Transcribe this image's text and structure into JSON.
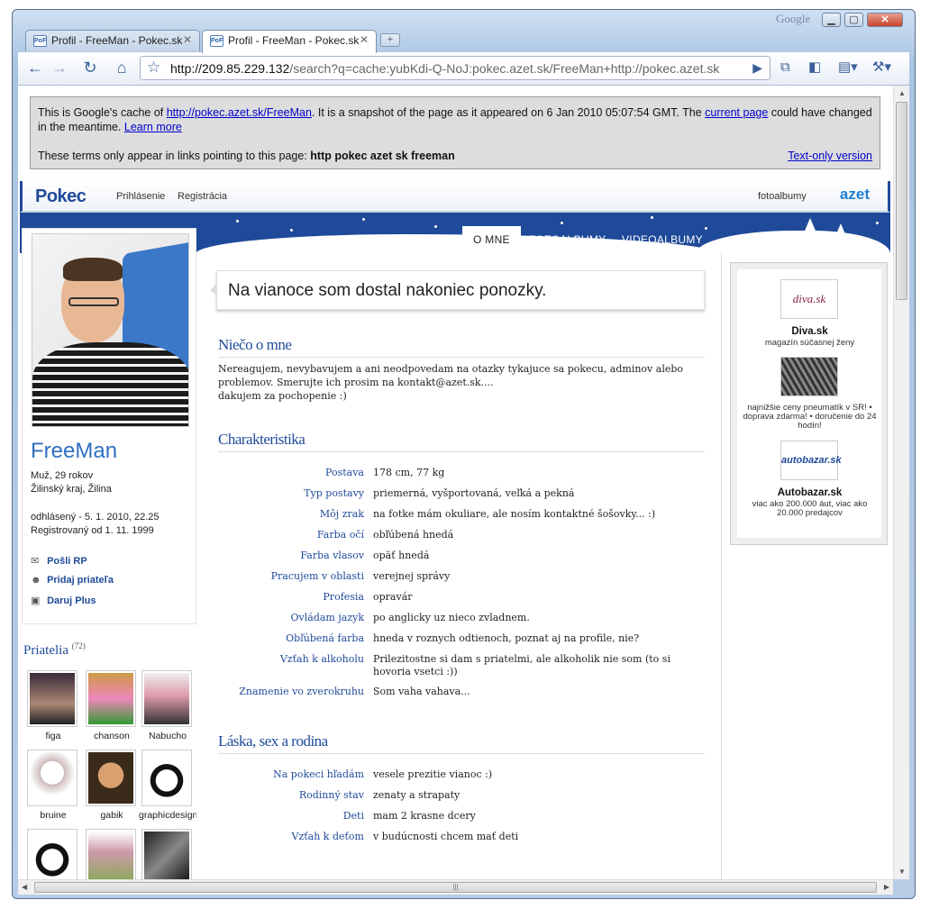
{
  "window": {
    "brand": "Google",
    "buttons": {
      "minimize": "▁",
      "maximize": "▢",
      "close": "✕"
    }
  },
  "tabs": [
    {
      "label": "Profil - FreeMan - Pokec.sk",
      "favicon": "PoF",
      "active": false
    },
    {
      "label": "Profil - FreeMan - Pokec.sk",
      "favicon": "PoF",
      "active": true
    }
  ],
  "toolbar": {
    "url_host": "http://209.85.229.132",
    "url_rest": "/search?q=cache:yubKdi-Q-NoJ:pokec.azet.sk/FreeMan+http://pokec.azet.sk",
    "icons": [
      "back-icon",
      "forward-icon",
      "reload-icon",
      "home-icon",
      "star-icon",
      "go-icon",
      "translate-icon",
      "extension-icon",
      "page-menu-icon",
      "wrench-icon"
    ]
  },
  "cache": {
    "p1_a": "This is Google's cache of ",
    "p1_link": "http://pokec.azet.sk/FreeMan",
    "p1_b": ". It is a snapshot of the page as it appeared on 6 Jan 2010 05:07:54 GMT. The ",
    "current_page": "current page",
    "p1_c": " could have changed in the meantime. ",
    "learn_more": "Learn more",
    "terms_label": "These terms only appear in links pointing to this page: ",
    "terms": "http pokec azet sk freeman",
    "text_only": "Text-only version"
  },
  "pokec": {
    "logo": "Pokec",
    "nav": [
      "Prihlásenie",
      "Registrácia"
    ],
    "right_link": "fotoalbumy",
    "azet_logo": "azet",
    "profile_tabs": [
      "O MNE",
      "FOTOALBUMY",
      "VIDEOALBUMY"
    ]
  },
  "profile": {
    "name": "FreeMan",
    "line1": "Muž, 29 rokov",
    "line2": "Žilinský kraj, Žilina",
    "line3": "odhlásený - 5. 1. 2010, 22.25",
    "line4": "Registrovaný od 1. 11. 1999",
    "actions": [
      "Pošli RP",
      "Pridaj priateľa",
      "Daruj Plus"
    ]
  },
  "friends": {
    "title": "Priatelia",
    "count": "(72)",
    "items": [
      "figa",
      "chanson",
      "Nabucho",
      "bruine",
      "gabik",
      "graphicdesign",
      "",
      "",
      ""
    ]
  },
  "status": "Na vianoce som dostal nakoniec ponozky.",
  "about": {
    "title": "Niečo o mne",
    "text1": "Nereagujem, nevybavujem a ani neodpovedam na otazky tykajuce sa pokecu, adminov alebo problemov. Smerujte ich prosim na kontakt@azet.sk....",
    "text2": "dakujem za pochopenie :)"
  },
  "char": {
    "title": "Charakteristika",
    "rows": [
      {
        "label": "Postava",
        "value": "178 cm, 77 kg"
      },
      {
        "label": "Typ postavy",
        "value": "priemerná, vyšportovaná, veľká a pekná"
      },
      {
        "label": "Môj zrak",
        "value": "na fotke mám okuliare, ale nosím kontaktné šošovky... :)"
      },
      {
        "label": "Farba očí",
        "value": "obľúbená hnedá"
      },
      {
        "label": "Farba vlasov",
        "value": "opäť hnedá"
      },
      {
        "label": "Pracujem v oblasti",
        "value": "verejnej správy"
      },
      {
        "label": "Profesia",
        "value": "opravár"
      },
      {
        "label": "Ovládam jazyk",
        "value": "po anglicky uz nieco zvladnem."
      },
      {
        "label": "Obľúbená farba",
        "value": "hneda v roznych odtienoch, poznat aj na profile, nie?"
      },
      {
        "label": "Vzťah k alkoholu",
        "value": "Prilezitostne si dam s priatelmi, ale alkoholik nie som (to si hovoria vsetci :))"
      },
      {
        "label": "Znamenie vo zverokruhu",
        "value": "Som vaha vahava..."
      }
    ]
  },
  "love": {
    "title": "Láska, sex a rodina",
    "rows": [
      {
        "label": "Na pokeci hľadám",
        "value": "vesele prezitie vianoc :)"
      },
      {
        "label": "Rodinný stav",
        "value": "zenaty a strapaty"
      },
      {
        "label": "Deti",
        "value": "mam 2 krasne dcery"
      },
      {
        "label": "Vzťah k deťom",
        "value": "v budúcnosti chcem mať deti"
      }
    ]
  },
  "ads": [
    {
      "logo": "diva.sk",
      "title": "Diva.sk",
      "text": "magazín súčasnej ženy"
    },
    {
      "logo": "",
      "title": "",
      "text": "najnižšie ceny pneumatík v SR! • doprava zdarma! • doručenie do 24 hodín!"
    },
    {
      "logo": "autobazar.sk",
      "title": "Autobazar.sk",
      "text": "viac ako 200.000 áut, viac ako 20.000 predajcov"
    }
  ],
  "colors": {
    "accent": "#1f4a9a",
    "link": "#0000cc",
    "name": "#2f6fbf"
  }
}
